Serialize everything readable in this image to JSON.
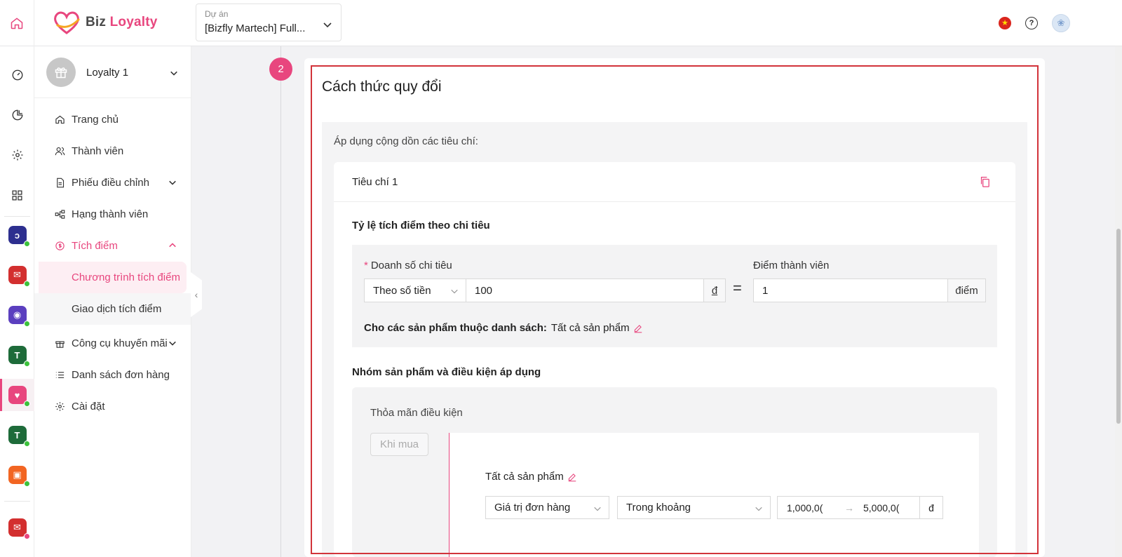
{
  "brand": {
    "name_part1": "Biz",
    "name_part2": "Loyalty"
  },
  "project_selector": {
    "label": "Dự án",
    "value": "[Bizfly Martech] Full..."
  },
  "sidebar": {
    "project_name": "Loyalty 1",
    "items": [
      {
        "label": "Trang chủ",
        "icon": "home-icon"
      },
      {
        "label": "Thành viên",
        "icon": "users-icon"
      },
      {
        "label": "Phiếu điều chỉnh",
        "icon": "document-icon"
      },
      {
        "label": "Hạng thành viên",
        "icon": "hierarchy-icon"
      },
      {
        "label": "Tích điểm",
        "icon": "coin-icon"
      },
      {
        "label": "Công cụ khuyến mãi",
        "icon": "gift-icon"
      },
      {
        "label": "Danh sách đơn hàng",
        "icon": "list-icon"
      },
      {
        "label": "Cài đặt",
        "icon": "gear-icon"
      }
    ],
    "sub_items": [
      {
        "label": "Chương trình tích điểm"
      },
      {
        "label": "Giao dịch tích điểm"
      }
    ]
  },
  "step": {
    "number": "2"
  },
  "section": {
    "title": "Cách thức quy đổi",
    "cumulative_label": "Áp dụng cộng dồn các tiêu chí:",
    "criterion": {
      "title": "Tiêu chí 1",
      "rate_title": "Tỷ lệ tích điểm theo chi tiêu",
      "spend_label": "Doanh số chi tiêu",
      "spend_type": "Theo số tiền",
      "spend_value": "100",
      "spend_unit": "đ",
      "equals": "=",
      "points_label": "Điểm thành viên",
      "points_value": "1",
      "points_unit": "điểm",
      "apply_label": "Cho các sản phẩm thuộc danh sách:",
      "apply_value": "Tất cả sản phẩm",
      "group_title": "Nhóm sản phẩm và điều kiện áp dụng",
      "condition_label": "Thỏa mãn điều kiện",
      "when_buy": "Khi mua",
      "products": "Tất cả sản phẩm",
      "condition_field": "Giá trị đơn hàng",
      "condition_operator": "Trong khoảng",
      "range_from": "1,000,0(",
      "range_arrow": "→",
      "range_to": "5,000,0(",
      "range_unit": "đ"
    }
  },
  "colors": {
    "accent": "#e8467e",
    "highlight": "#d2333a"
  }
}
